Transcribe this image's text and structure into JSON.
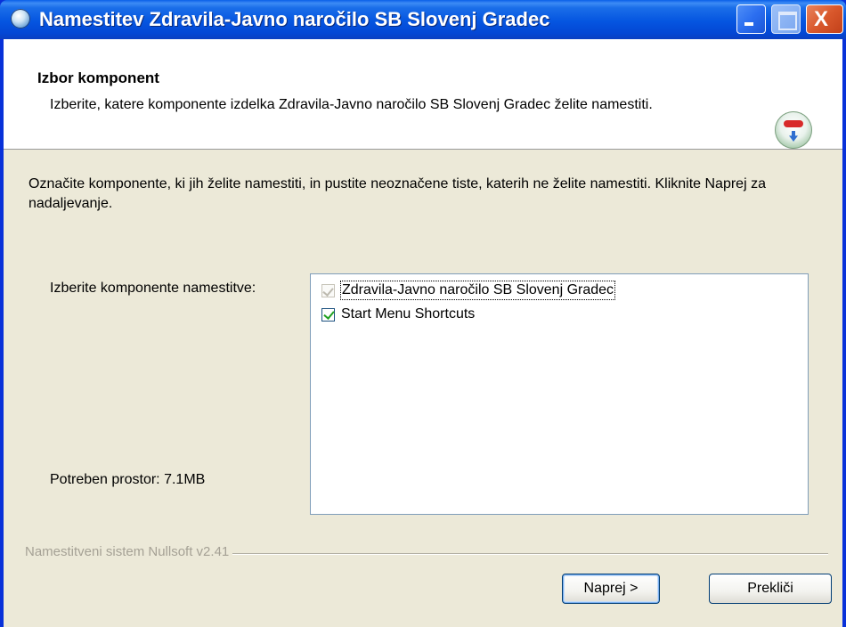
{
  "window": {
    "title": "Namestitev Zdravila-Javno naročilo SB Slovenj Gradec",
    "controls": {
      "minimize": "_",
      "maximize": "□",
      "close": "X"
    }
  },
  "header": {
    "title": "Izbor komponent",
    "description": "Izberite, katere komponente izdelka Zdravila-Javno naročilo SB Slovenj Gradec želite namestiti."
  },
  "body": {
    "instructions": "Označite komponente, ki jih želite namestiti, in pustite neoznačene tiste, katerih ne želite namestiti. Kliknite Naprej za nadaljevanje.",
    "components_label": "Izberite komponente namestitve:",
    "space_required": "Potreben prostor: 7.1MB",
    "components": [
      {
        "label": "Zdravila-Javno naročilo SB Slovenj Gradec",
        "checked": true,
        "disabled": true
      },
      {
        "label": "Start Menu Shortcuts",
        "checked": true,
        "disabled": false
      }
    ]
  },
  "footer": {
    "branding": "Namestitveni sistem Nullsoft v2.41",
    "next_button": "Naprej >",
    "cancel_button": "Prekliči"
  },
  "icons": {
    "title": "installer-icon",
    "header": "install-disc-icon"
  }
}
